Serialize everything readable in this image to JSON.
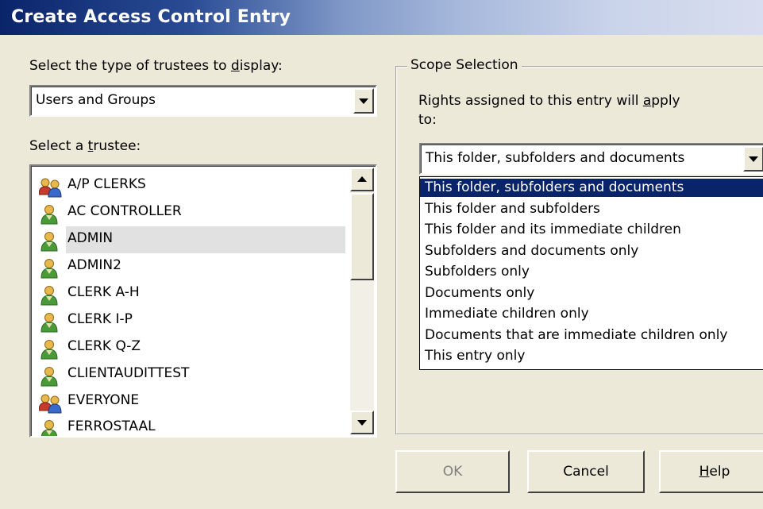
{
  "window": {
    "title": "Create Access Control Entry"
  },
  "trustee_type": {
    "label_pre": "Select the type of trustees to ",
    "label_accel": "d",
    "label_post": "isplay:",
    "value": "Users and Groups"
  },
  "trustee": {
    "label_pre": "Select a ",
    "label_accel": "t",
    "label_post": "rustee:",
    "items": [
      {
        "name": "A/P CLERKS",
        "icon": "group-icon"
      },
      {
        "name": "AC CONTROLLER",
        "icon": "user-icon"
      },
      {
        "name": "ADMIN",
        "icon": "user-icon"
      },
      {
        "name": "ADMIN2",
        "icon": "user-icon"
      },
      {
        "name": "CLERK A-H",
        "icon": "user-icon"
      },
      {
        "name": "CLERK I-P",
        "icon": "user-icon"
      },
      {
        "name": "CLERK Q-Z",
        "icon": "user-icon"
      },
      {
        "name": "CLIENTAUDITTEST",
        "icon": "user-icon"
      },
      {
        "name": "EVERYONE",
        "icon": "group-icon"
      },
      {
        "name": "FERROSTAAL",
        "icon": "user-icon"
      }
    ],
    "selected": "ADMIN"
  },
  "scope": {
    "legend": "Scope Selection",
    "description_pre": "Rights assigned to this entry will ",
    "description_accel": "a",
    "description_post": "pply",
    "description_line2": "to:",
    "value": "This folder, subfolders and documents",
    "options": [
      "This folder, subfolders and documents",
      "This folder and subfolders",
      "This folder and its immediate children",
      "Subfolders and documents only",
      "Subfolders only",
      "Documents only",
      "Immediate children only",
      "Documents that are immediate children only",
      "This entry only"
    ]
  },
  "buttons": {
    "ok": "OK",
    "cancel": "Cancel",
    "help_accel": "H",
    "help_rest": "elp"
  },
  "colors": {
    "highlight": "#0a246a",
    "face": "#ece9d8"
  }
}
